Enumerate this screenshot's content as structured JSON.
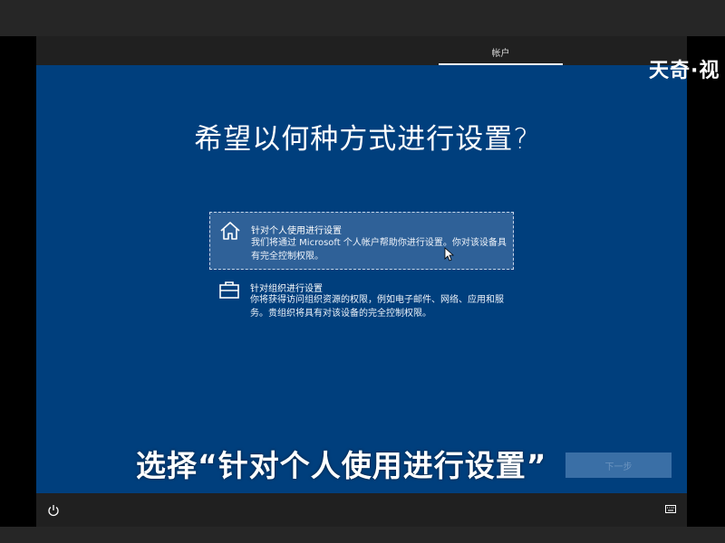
{
  "header": {
    "tab_label": "帐户"
  },
  "main": {
    "title": "希望以何种方式进行设置?",
    "options": [
      {
        "title": "针对个人使用进行设置",
        "description": "我们将通过 Microsoft 个人帐户帮助你进行设置。你对该设备具有完全控制权限。",
        "icon": "home-icon",
        "selected": true
      },
      {
        "title": "针对组织进行设置",
        "description": "你将获得访问组织资源的权限，例如电子邮件、网络、应用和服务。贵组织将具有对该设备的完全控制权限。",
        "icon": "briefcase-icon",
        "selected": false
      }
    ],
    "next_button_label": "下一步"
  },
  "footer": {
    "left_icon": "power-icon",
    "right_icon": "keyboard-icon"
  },
  "overlay": {
    "caption": "选择“针对个人使用进行设置”",
    "watermark": "天奇·视"
  },
  "colors": {
    "background": "#003f7d",
    "selected_option": "#2f6198",
    "bar": "#202020",
    "text": "#ffffff"
  }
}
